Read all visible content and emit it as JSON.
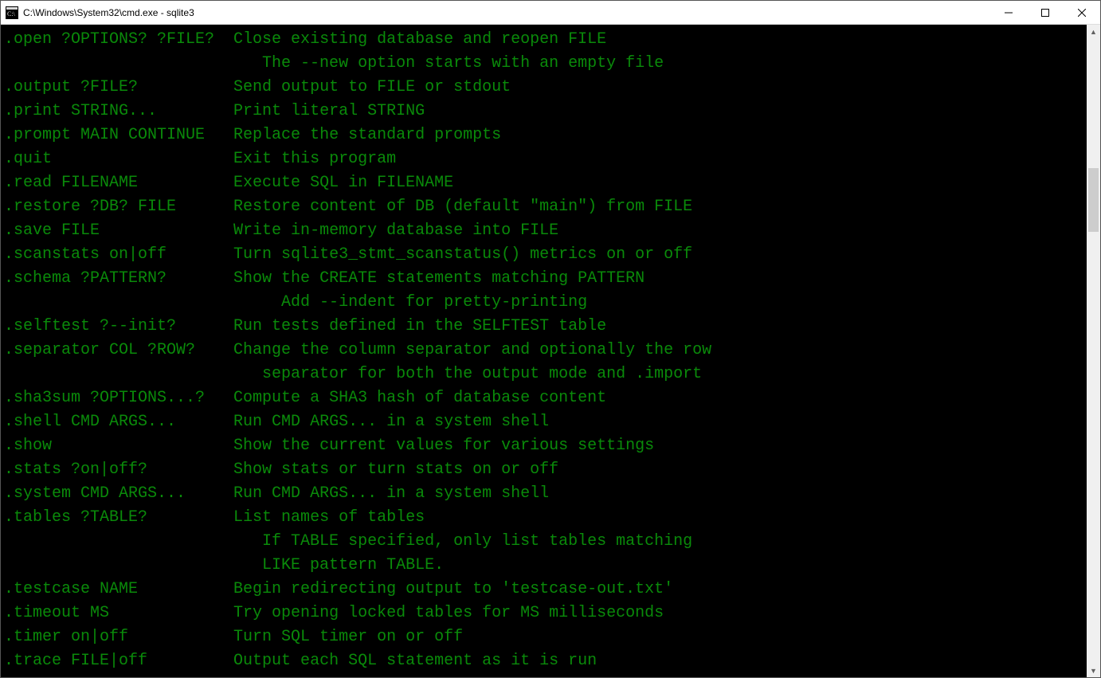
{
  "window": {
    "title": "C:\\Windows\\System32\\cmd.exe - sqlite3"
  },
  "colors": {
    "terminal_bg": "#000000",
    "terminal_fg": "#0a8a0a"
  },
  "help_entries": [
    {
      "cmd": ".open ?OPTIONS? ?FILE?",
      "desc": "Close existing database and reopen FILE",
      "cont": [
        "The --new option starts with an empty file"
      ]
    },
    {
      "cmd": ".output ?FILE?",
      "desc": "Send output to FILE or stdout",
      "cont": []
    },
    {
      "cmd": ".print STRING...",
      "desc": "Print literal STRING",
      "cont": []
    },
    {
      "cmd": ".prompt MAIN CONTINUE",
      "desc": "Replace the standard prompts",
      "cont": []
    },
    {
      "cmd": ".quit",
      "desc": "Exit this program",
      "cont": []
    },
    {
      "cmd": ".read FILENAME",
      "desc": "Execute SQL in FILENAME",
      "cont": []
    },
    {
      "cmd": ".restore ?DB? FILE",
      "desc": "Restore content of DB (default \"main\") from FILE",
      "cont": []
    },
    {
      "cmd": ".save FILE",
      "desc": "Write in-memory database into FILE",
      "cont": []
    },
    {
      "cmd": ".scanstats on|off",
      "desc": "Turn sqlite3_stmt_scanstatus() metrics on or off",
      "cont": []
    },
    {
      "cmd": ".schema ?PATTERN?",
      "desc": "Show the CREATE statements matching PATTERN",
      "cont": [
        "  Add --indent for pretty-printing"
      ]
    },
    {
      "cmd": ".selftest ?--init?",
      "desc": "Run tests defined in the SELFTEST table",
      "cont": []
    },
    {
      "cmd": ".separator COL ?ROW?",
      "desc": "Change the column separator and optionally the row",
      "cont": [
        "separator for both the output mode and .import"
      ]
    },
    {
      "cmd": ".sha3sum ?OPTIONS...?",
      "desc": "Compute a SHA3 hash of database content",
      "cont": []
    },
    {
      "cmd": ".shell CMD ARGS...",
      "desc": "Run CMD ARGS... in a system shell",
      "cont": []
    },
    {
      "cmd": ".show",
      "desc": "Show the current values for various settings",
      "cont": []
    },
    {
      "cmd": ".stats ?on|off?",
      "desc": "Show stats or turn stats on or off",
      "cont": []
    },
    {
      "cmd": ".system CMD ARGS...",
      "desc": "Run CMD ARGS... in a system shell",
      "cont": []
    },
    {
      "cmd": ".tables ?TABLE?",
      "desc": "List names of tables",
      "cont": [
        "If TABLE specified, only list tables matching",
        "LIKE pattern TABLE."
      ]
    },
    {
      "cmd": ".testcase NAME",
      "desc": "Begin redirecting output to 'testcase-out.txt'",
      "cont": []
    },
    {
      "cmd": ".timeout MS",
      "desc": "Try opening locked tables for MS milliseconds",
      "cont": []
    },
    {
      "cmd": ".timer on|off",
      "desc": "Turn SQL timer on or off",
      "cont": []
    },
    {
      "cmd": ".trace FILE|off",
      "desc": "Output each SQL statement as it is run",
      "cont": []
    }
  ]
}
